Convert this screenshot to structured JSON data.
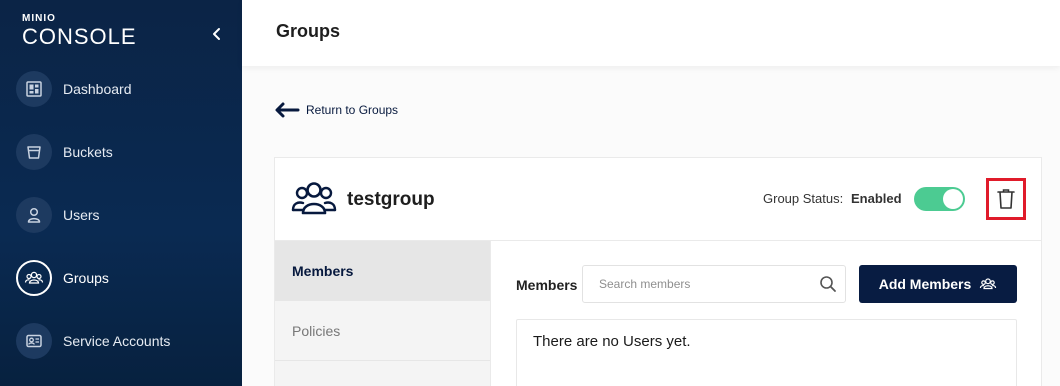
{
  "brand": {
    "small": "MINIO",
    "big": "CONSOLE"
  },
  "sidebar": {
    "items": [
      {
        "label": "Dashboard",
        "icon": "dashboard-icon"
      },
      {
        "label": "Buckets",
        "icon": "bucket-icon"
      },
      {
        "label": "Users",
        "icon": "user-icon"
      },
      {
        "label": "Groups",
        "icon": "groups-icon",
        "active": true
      },
      {
        "label": "Service Accounts",
        "icon": "service-account-icon"
      }
    ]
  },
  "header": {
    "title": "Groups"
  },
  "back": {
    "label": "Return to Groups"
  },
  "group": {
    "name": "testgroup",
    "status_label": "Group Status:",
    "status_value": "Enabled",
    "enabled": true
  },
  "tabs": [
    {
      "label": "Members",
      "active": true
    },
    {
      "label": "Policies",
      "active": false
    }
  ],
  "members": {
    "label": "Members",
    "search_placeholder": "Search members",
    "add_label": "Add Members",
    "empty_text": "There are no Users yet."
  },
  "colors": {
    "sidebar": "#0b2446",
    "accent": "#081c42",
    "toggle_on": "#4ccb92",
    "highlight": "#e01b2a"
  }
}
